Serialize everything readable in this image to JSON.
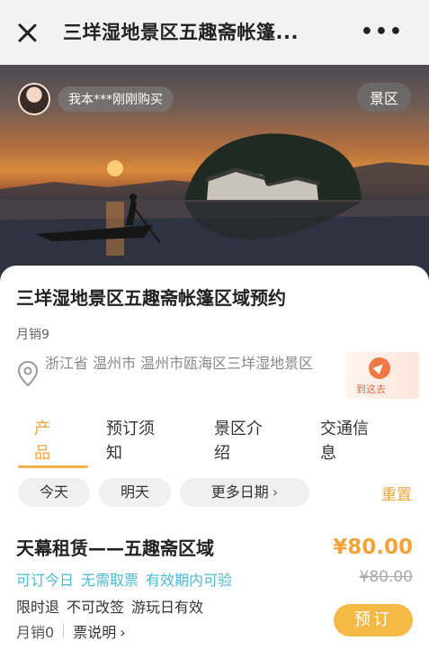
{
  "topbar": {
    "title": "三垟湿地景区五趣斋帐篷...",
    "more_label": "•••"
  },
  "hero": {
    "buyer_notice": "我本***刚刚购买",
    "category_tag": "景区"
  },
  "product": {
    "title": "三垟湿地景区五趣斋帐篷区域预约",
    "monthly_sales": "月销9",
    "address": "浙江省 温州市 温州市瓯海区三垟湿地景区",
    "navigate_label": "到这去"
  },
  "tabs": [
    {
      "label": "产品",
      "line1": "产",
      "line2": "品",
      "active": true
    },
    {
      "label": "预订须知",
      "line1": "预订须",
      "line2": "知",
      "active": false
    },
    {
      "label": "景区介绍",
      "line1": "景区介",
      "line2": "绍",
      "active": false
    },
    {
      "label": "交通信息",
      "line1": "交通信",
      "line2": "息",
      "active": false
    }
  ],
  "date_filter": {
    "today": "今天",
    "tomorrow": "明天",
    "more_dates": "更多日期",
    "reset": "重置"
  },
  "offer": {
    "title": "天幕租赁——五趣斋区域",
    "price": "¥80.00",
    "original_price": "¥80.00",
    "tags": [
      "可订今日",
      "无需取票",
      "有效期内可验"
    ],
    "rules": [
      "限时退",
      "不可改签",
      "游玩日有效"
    ],
    "monthly_sales": "月销0",
    "ticket_note": "票说明",
    "book_label": "预订"
  },
  "colors": {
    "accent": "#f0a43a",
    "tag_blue": "#4eb7d0",
    "nav_orange": "#f07845"
  }
}
